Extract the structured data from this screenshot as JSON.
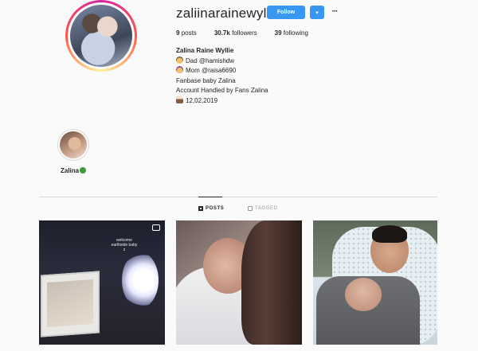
{
  "profile": {
    "username": "zaliinarainewyllie",
    "follow_label": "Follow",
    "dropdown_glyph": "▾",
    "more_glyph": "···",
    "stats": {
      "posts_count": "9",
      "posts_label": "posts",
      "followers_count": "30.7k",
      "followers_label": "followers",
      "following_count": "39",
      "following_label": "following"
    },
    "bio": {
      "full_name": "Zalina Raine Wyllie",
      "line_dad": "Dad @hamishdw",
      "line_mom": "Mom @raisa6690",
      "line_fanbase": "Fanbase baby Zalina",
      "line_account": "Account Handled by Fans Zalina",
      "line_date": "12,02,2019"
    }
  },
  "highlights": [
    {
      "label": "Zalina"
    }
  ],
  "tabs": {
    "posts_label": "POSTS",
    "tagged_label": "TAGGED",
    "active": "posts"
  },
  "posts": {
    "first_overlay_text": "welcome earthside baby z"
  },
  "colors": {
    "accent": "#3897f0",
    "background": "#fafafa",
    "divider": "#dbdbdb",
    "text": "#262626"
  }
}
